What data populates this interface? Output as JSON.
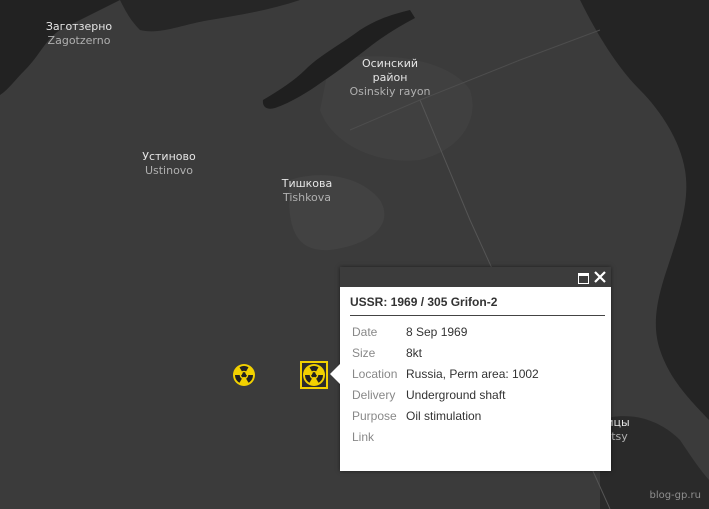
{
  "map": {
    "places": [
      {
        "ru": "Заготзерно",
        "en": "Zagotzerno"
      },
      {
        "ru": "Осинский",
        "ru2": "район",
        "en": "Osinskiy rayon"
      },
      {
        "ru": "Устиново",
        "en": "Ustinovo"
      },
      {
        "ru": "Тишкова",
        "en": "Tishkova"
      },
      {
        "ru": "ицы",
        "en": "itsy"
      }
    ],
    "markers": [
      {
        "name": "radiation-marker",
        "icon": "radiation-icon",
        "selected": false
      },
      {
        "name": "radiation-marker-selected",
        "icon": "radiation-icon",
        "selected": true
      }
    ],
    "colors": {
      "land": "#3b3b3b",
      "water": "#1f1f1f",
      "marker_fill": "#f2d100",
      "selection": "#f2d100"
    }
  },
  "popup": {
    "title": "USSR: 1969 / 305 Grifon-2",
    "rows": [
      {
        "key": "Date",
        "value": "8 Sep 1969"
      },
      {
        "key": "Size",
        "value": "8kt"
      },
      {
        "key": "Location",
        "value": "Russia, Perm area: 1002"
      },
      {
        "key": "Delivery",
        "value": "Underground shaft"
      },
      {
        "key": "Purpose",
        "value": "Oil stimulation"
      },
      {
        "key": "Link",
        "value": ""
      }
    ]
  },
  "watermark": "blog-gp.ru"
}
